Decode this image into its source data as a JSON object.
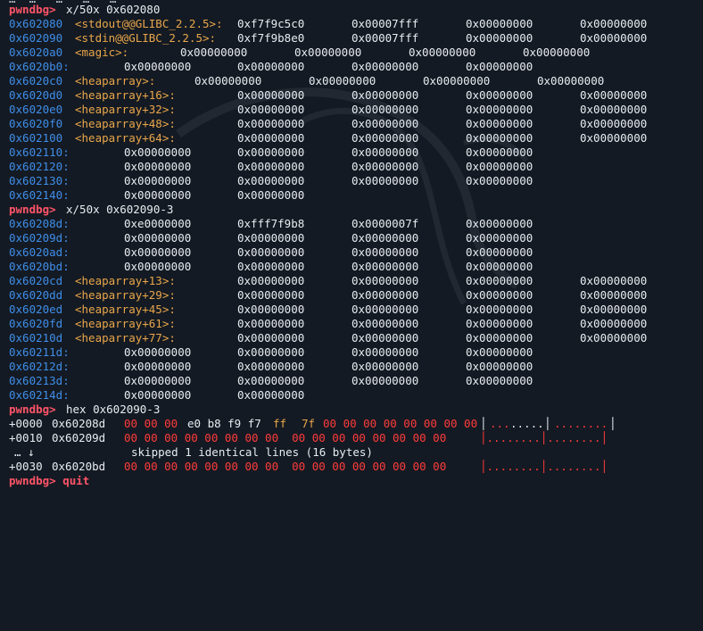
{
  "prompt": "pwndbg>",
  "top_cut": "…  …   …   …   …",
  "commands": {
    "cmd1": "x/50x 0x602080",
    "cmd2": "x/50x 0x602090-3",
    "cmd3": "hex 0x602090-3"
  },
  "block1": [
    {
      "addr": "0x602080",
      "sym": "<stdout@@GLIBC_2.2.5>:",
      "vals": [
        "0xf7f9c5c0",
        "0x00007fff",
        "0x00000000",
        "0x00000000"
      ]
    },
    {
      "addr": "0x602090",
      "sym": "<stdin@@GLIBC_2.2.5>:",
      "vals": [
        "0xf7f9b8e0",
        "0x00007fff",
        "0x00000000",
        "0x00000000"
      ]
    },
    {
      "addr": "0x6020a0",
      "sym": "<magic>:",
      "vals": [
        "0x00000000",
        "0x00000000",
        "0x00000000",
        "0x00000000"
      ]
    },
    {
      "addr": "0x6020b0:",
      "sym": "",
      "vals": [
        "0x00000000",
        "0x00000000",
        "0x00000000",
        "0x00000000"
      ]
    },
    {
      "addr": "0x6020c0",
      "sym": "<heaparray>:",
      "vals": [
        "0x00000000",
        "0x00000000",
        "0x00000000",
        "0x00000000"
      ]
    },
    {
      "addr": "0x6020d0",
      "sym": "<heaparray+16>:",
      "vals": [
        "0x00000000",
        "0x00000000",
        "0x00000000",
        "0x00000000"
      ]
    },
    {
      "addr": "0x6020e0",
      "sym": "<heaparray+32>:",
      "vals": [
        "0x00000000",
        "0x00000000",
        "0x00000000",
        "0x00000000"
      ]
    },
    {
      "addr": "0x6020f0",
      "sym": "<heaparray+48>:",
      "vals": [
        "0x00000000",
        "0x00000000",
        "0x00000000",
        "0x00000000"
      ]
    },
    {
      "addr": "0x602100",
      "sym": "<heaparray+64>:",
      "vals": [
        "0x00000000",
        "0x00000000",
        "0x00000000",
        "0x00000000"
      ]
    },
    {
      "addr": "0x602110:",
      "sym": "",
      "vals": [
        "0x00000000",
        "0x00000000",
        "0x00000000",
        "0x00000000"
      ]
    },
    {
      "addr": "0x602120:",
      "sym": "",
      "vals": [
        "0x00000000",
        "0x00000000",
        "0x00000000",
        "0x00000000"
      ]
    },
    {
      "addr": "0x602130:",
      "sym": "",
      "vals": [
        "0x00000000",
        "0x00000000",
        "0x00000000",
        "0x00000000"
      ]
    },
    {
      "addr": "0x602140:",
      "sym": "",
      "vals": [
        "0x00000000",
        "0x00000000"
      ]
    }
  ],
  "block2": [
    {
      "addr": "0x60208d:",
      "sym": "",
      "vals": [
        "0xe0000000",
        "0xfff7f9b8",
        "0x0000007f",
        "0x00000000"
      ]
    },
    {
      "addr": "0x60209d:",
      "sym": "",
      "vals": [
        "0x00000000",
        "0x00000000",
        "0x00000000",
        "0x00000000"
      ]
    },
    {
      "addr": "0x6020ad:",
      "sym": "",
      "vals": [
        "0x00000000",
        "0x00000000",
        "0x00000000",
        "0x00000000"
      ]
    },
    {
      "addr": "0x6020bd:",
      "sym": "",
      "vals": [
        "0x00000000",
        "0x00000000",
        "0x00000000",
        "0x00000000"
      ]
    },
    {
      "addr": "0x6020cd",
      "sym": "<heaparray+13>:",
      "vals": [
        "0x00000000",
        "0x00000000",
        "0x00000000",
        "0x00000000"
      ]
    },
    {
      "addr": "0x6020dd",
      "sym": "<heaparray+29>:",
      "vals": [
        "0x00000000",
        "0x00000000",
        "0x00000000",
        "0x00000000"
      ]
    },
    {
      "addr": "0x6020ed",
      "sym": "<heaparray+45>:",
      "vals": [
        "0x00000000",
        "0x00000000",
        "0x00000000",
        "0x00000000"
      ]
    },
    {
      "addr": "0x6020fd",
      "sym": "<heaparray+61>:",
      "vals": [
        "0x00000000",
        "0x00000000",
        "0x00000000",
        "0x00000000"
      ]
    },
    {
      "addr": "0x60210d",
      "sym": "<heaparray+77>:",
      "vals": [
        "0x00000000",
        "0x00000000",
        "0x00000000",
        "0x00000000"
      ]
    },
    {
      "addr": "0x60211d:",
      "sym": "",
      "vals": [
        "0x00000000",
        "0x00000000",
        "0x00000000",
        "0x00000000"
      ]
    },
    {
      "addr": "0x60212d:",
      "sym": "",
      "vals": [
        "0x00000000",
        "0x00000000",
        "0x00000000",
        "0x00000000"
      ]
    },
    {
      "addr": "0x60213d:",
      "sym": "",
      "vals": [
        "0x00000000",
        "0x00000000",
        "0x00000000",
        "0x00000000"
      ]
    },
    {
      "addr": "0x60214d:",
      "sym": "",
      "vals": [
        "0x00000000",
        "0x00000000"
      ]
    }
  ],
  "hexdump": {
    "row1_offset": "+0000",
    "row1_addr": "0x60208d",
    "row1_bytes_a": "00 00 00",
    "row1_bytes_b": "e0 b8 f9 f7",
    "row1_bytes_c": "ff",
    "row1_bytes_d": "7f",
    "row1_bytes_e": "00 00 00 00 00 00 00 00",
    "row1_ascii_a": "│",
    "row1_ascii_b": "...",
    "row1_ascii_c": ".....",
    "row1_ascii_d": "│",
    "row1_ascii_e": "........",
    "row1_ascii_f": "│",
    "row2_offset": "+0010",
    "row2_addr": "0x60209d",
    "row2_bytes": "00 00 00 00 00 00 00 00  00 00 00 00 00 00 00 00",
    "row2_ascii": "│........│........│",
    "skip_marker": "… ↓",
    "skip_text": "skipped 1 identical lines (16 bytes)",
    "row3_offset": "+0030",
    "row3_addr": "0x6020bd",
    "row3_bytes": "00 00 00 00 00 00 00 00  00 00 00 00 00 00 00 00",
    "row3_ascii": "│........│........│"
  },
  "bottom_cut": "pwndbg> quit",
  "colors": {
    "background": "#141a23",
    "prompt": "#ff5468",
    "address": "#3f8ee8",
    "symbol": "#e9a64a",
    "zero_byte": "#ff3b3b"
  }
}
